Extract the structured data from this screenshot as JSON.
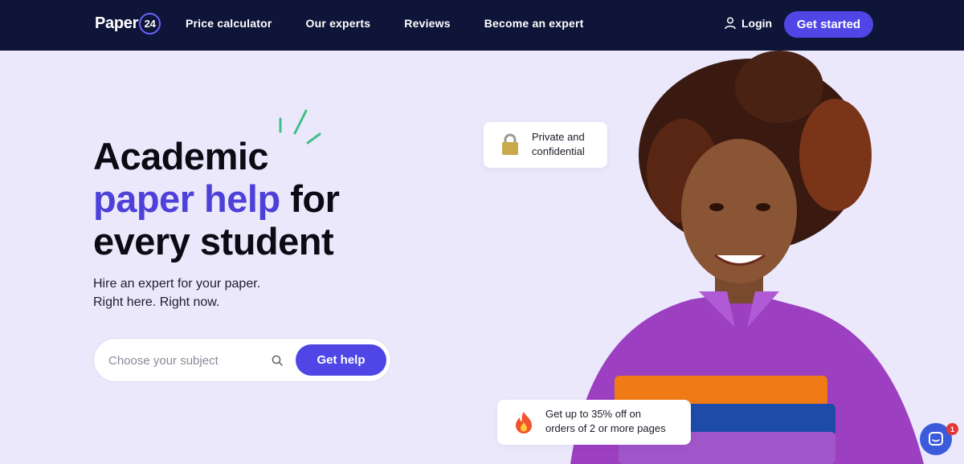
{
  "header": {
    "logo_text": "Paper",
    "logo_number": "24",
    "nav": [
      {
        "label": "Price calculator"
      },
      {
        "label": "Our experts"
      },
      {
        "label": "Reviews"
      },
      {
        "label": "Become an expert"
      }
    ],
    "login_label": "Login",
    "cta_label": "Get started"
  },
  "hero": {
    "headline_line1": "Academic",
    "headline_accent": "paper help",
    "headline_after_accent": " for",
    "headline_line3": "every student",
    "sub_line1": "Hire an expert for your paper.",
    "sub_line2": "Right here. Right now.",
    "search_placeholder": "Choose your subject",
    "search_value": "",
    "help_button": "Get help"
  },
  "cards": {
    "private_line1": "Private and",
    "private_line2": "confidential",
    "private_icon": "lock-icon",
    "offer_line1": "Get up to 35% off on",
    "offer_line2": "orders of 2 or more pages",
    "offer_icon": "fire-icon"
  },
  "chat": {
    "badge_count": "1",
    "icon": "chat-icon"
  },
  "colors": {
    "header_bg": "#0e1538",
    "page_bg": "#ebe8fb",
    "accent": "#4f46e5",
    "headline_accent": "#4d41d9",
    "badge": "#e53935"
  }
}
